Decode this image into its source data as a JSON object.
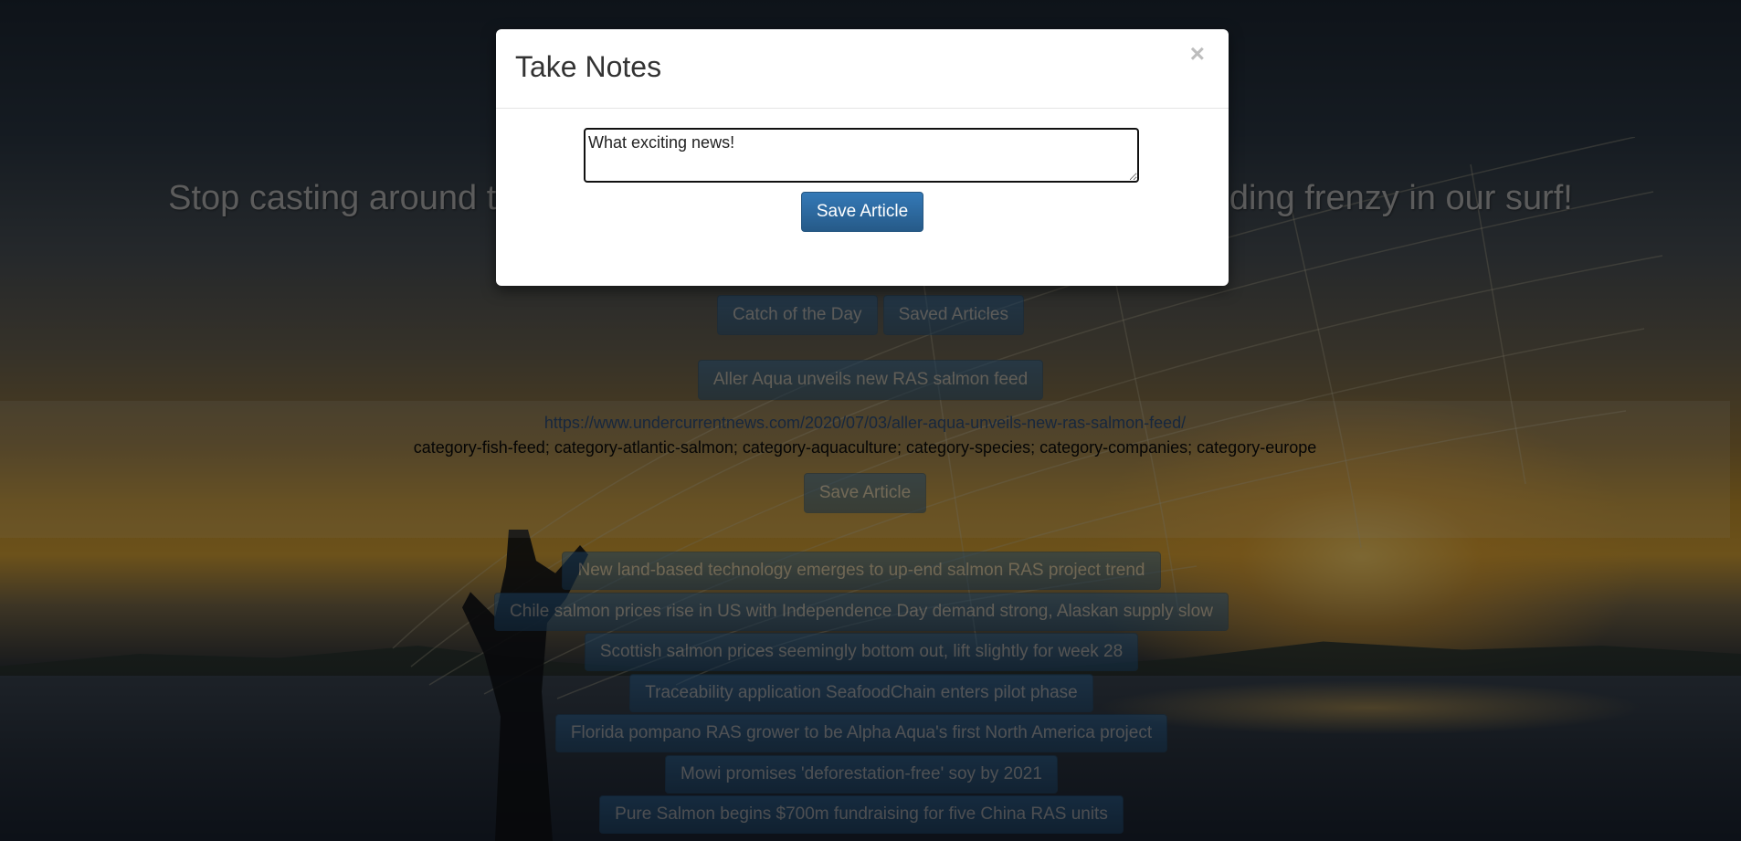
{
  "page": {
    "headline": "Stop casting around the Internet for salmon news — join the newsfeeding frenzy in our surf!",
    "nav": {
      "catch_of_the_day": "Catch of the Day",
      "saved_articles": "Saved Articles"
    },
    "featured_article": {
      "title": "Aller Aqua unveils new RAS salmon feed",
      "url": "https://www.undercurrentnews.com/2020/07/03/aller-aqua-unveils-new-ras-salmon-feed/",
      "categories": "category-fish-feed; category-atlantic-salmon; category-aquaculture; category-species; category-companies; category-europe",
      "save_label": "Save Article"
    },
    "headlines": [
      "New land-based technology emerges to up-end salmon RAS project trend",
      "Chile salmon prices rise in US with Independence Day demand strong, Alaskan supply slow",
      "Scottish salmon prices seemingly bottom out, lift slightly for week 28",
      "Traceability application SeafoodChain enters pilot phase",
      "Florida pompano RAS grower to be Alpha Aqua's first North America project",
      "Mowi promises 'deforestation-free' soy by 2021",
      "Pure Salmon begins $700m fundraising for five China RAS units"
    ]
  },
  "modal": {
    "title": "Take Notes",
    "close_symbol": "×",
    "note_value": "What exciting news!",
    "save_label": "Save Article"
  },
  "colors": {
    "button_primary": "#337ab7",
    "link": "#2f4f7a",
    "overlay": "rgba(0,0,0,0.5)"
  }
}
